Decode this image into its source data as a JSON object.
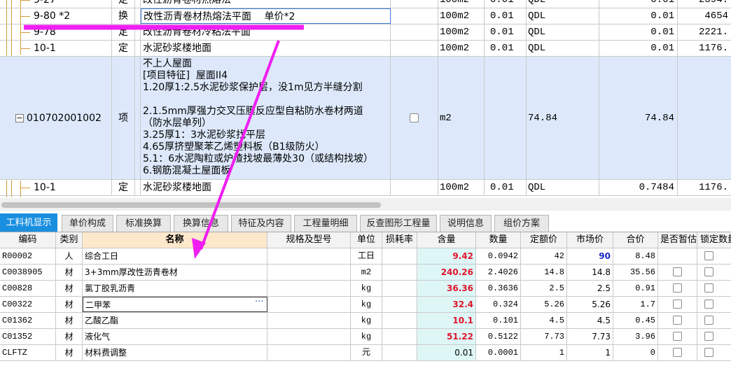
{
  "top_rows": [
    {
      "code": "9-27",
      "type": "定",
      "name": "改性沥青卷材热熔法",
      "unit": "100m2",
      "qty": "0.01",
      "qdl": "QDL",
      "qty2": "0.01",
      "price": "2394."
    },
    {
      "code": "9-80 *2",
      "type": "换",
      "name": "改性沥青卷材热熔法平面　 单价*2",
      "unit": "100m2",
      "qty": "0.01",
      "qdl": "QDL",
      "qty2": "0.01",
      "price": "4654"
    },
    {
      "code": "9-78",
      "type": "定",
      "name": "改性沥青卷材冷粘法平面",
      "unit": "100m2",
      "qty": "0.01",
      "qdl": "QDL",
      "qty2": "0.01",
      "price": "2221."
    },
    {
      "code": "10-1",
      "type": "定",
      "name": "水泥砂浆楼地面",
      "unit": "100m2",
      "qty": "0.01",
      "qdl": "QDL",
      "qty2": "0.01",
      "price": "1176."
    }
  ],
  "selected_item": {
    "toggle": "−",
    "code": "010702001002",
    "type": "项",
    "desc_lines": [
      "不上人屋面",
      "[项目特征]  屋面II4",
      "1.20厚1:2.5水泥砂浆保护层，没1m见方半缝分割",
      "",
      "2.1.5mm厚强力交叉压膜反应型自粘防水卷材两道",
      "（防水层单列）",
      "3.25厚1：3水泥砂浆找平层",
      "4.65厚挤塑聚苯乙烯塑料板（B1级防火）",
      "5.1：6水泥陶粒或炉渣找坡最薄处30（或结构找坡）",
      "6.钢筋混凝土屋面板"
    ],
    "unit": "m2",
    "qty": "74.84",
    "qty2": "74.84"
  },
  "after_row": {
    "code": "10-1",
    "type": "定",
    "name": "水泥砂浆楼地面",
    "unit": "100m2",
    "qty": "0.01",
    "qdl": "QDL",
    "qty2": "0.7484",
    "price": "1176."
  },
  "tabs": [
    "工料机显示",
    "单价构成",
    "标准换算",
    "换算信息",
    "特征及内容",
    "工程量明细",
    "反查图形工程量",
    "说明信息",
    "组价方案"
  ],
  "headers": [
    "编码",
    "类别",
    "名称",
    "规格及型号",
    "单位",
    "损耗率",
    "含量",
    "数量",
    "定额价",
    "市场价",
    "合价",
    "是否暂估",
    "锁定数量"
  ],
  "materials": [
    {
      "code": "R00002",
      "cat": "人",
      "name": "综合工日",
      "spec": "",
      "unit": "工日",
      "loss": "",
      "content": "9.42",
      "qty": "0.0942",
      "quota": "42",
      "market": "90",
      "total": "8.48",
      "has_check": false
    },
    {
      "code": "C0038905",
      "cat": "材",
      "name": "3+3mm厚改性沥青卷材",
      "spec": "",
      "unit": "m2",
      "loss": "",
      "content": "240.26",
      "qty": "2.4026",
      "quota": "14.8",
      "market": "14.8",
      "total": "35.56",
      "has_check": true
    },
    {
      "code": "C00828",
      "cat": "材",
      "name": "氯丁胶乳沥青",
      "spec": "",
      "unit": "kg",
      "loss": "",
      "content": "36.36",
      "qty": "0.3636",
      "quota": "2.5",
      "market": "2.5",
      "total": "0.91",
      "has_check": true
    },
    {
      "code": "C00322",
      "cat": "材",
      "name": "二甲苯",
      "spec": "",
      "unit": "kg",
      "loss": "",
      "content": "32.4",
      "qty": "0.324",
      "quota": "5.26",
      "market": "5.26",
      "total": "1.7",
      "has_check": true
    },
    {
      "code": "C01362",
      "cat": "材",
      "name": "乙酸乙酯",
      "spec": "",
      "unit": "kg",
      "loss": "",
      "content": "10.1",
      "qty": "0.101",
      "quota": "4.5",
      "market": "4.5",
      "total": "0.45",
      "has_check": true
    },
    {
      "code": "C01352",
      "cat": "材",
      "name": "液化气",
      "spec": "",
      "unit": "kg",
      "loss": "",
      "content": "51.22",
      "qty": "0.5122",
      "quota": "7.73",
      "market": "7.73",
      "total": "3.96",
      "has_check": true
    },
    {
      "code": "CLFTZ",
      "cat": "材",
      "name": "材料费调整",
      "spec": "",
      "unit": "元",
      "loss": "",
      "content": "0.01",
      "qty": "0.0001",
      "quota": "1",
      "market": "1",
      "total": "0",
      "has_check": true
    }
  ],
  "ellipsis": "···",
  "colors": {
    "active_tab": "#1a8fe0",
    "highlight": "#dde9fb",
    "annotation": "#f01ef0",
    "content_bg": "#def6f6",
    "red_text": "#e0152b",
    "blue_text": "#1727c7"
  }
}
